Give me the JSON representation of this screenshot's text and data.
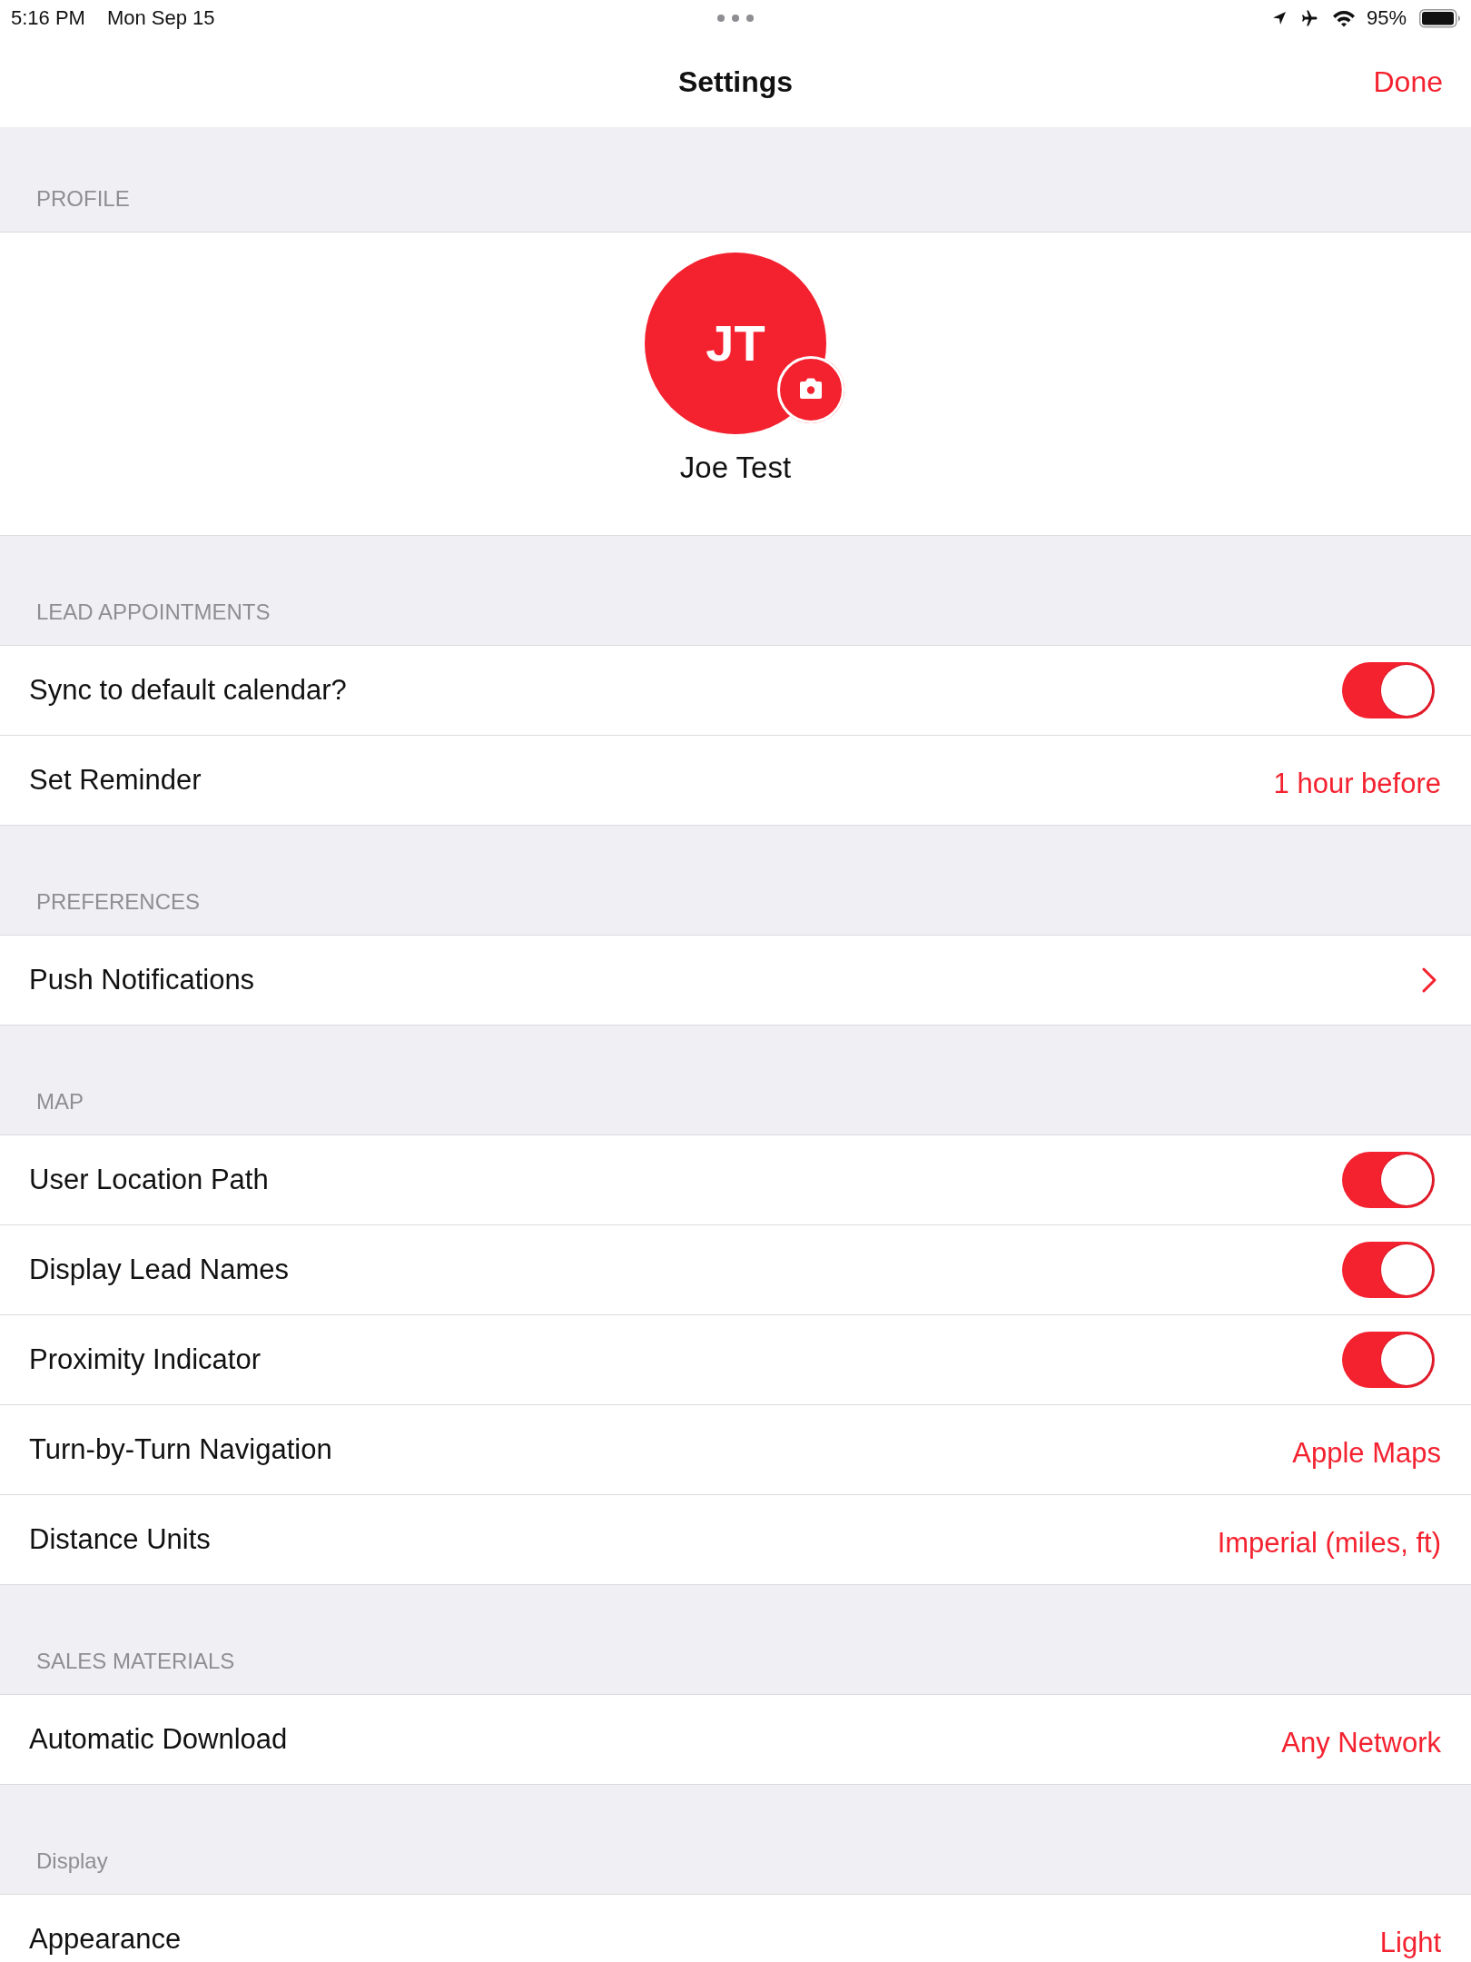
{
  "status_bar": {
    "time": "5:16 PM",
    "date": "Mon Sep 15",
    "battery_text": "95%"
  },
  "nav_bar": {
    "title": "Settings",
    "done_button": "Done"
  },
  "profile": {
    "header": "PROFILE",
    "initials": "JT",
    "name": "Joe Test"
  },
  "sections": [
    {
      "header": "LEAD APPOINTMENTS",
      "rows": [
        {
          "kind": "toggle",
          "label": "Sync to default calendar?",
          "on": true
        },
        {
          "kind": "value",
          "label": "Set Reminder",
          "value": "1 hour before"
        }
      ]
    },
    {
      "header": "PREFERENCES",
      "rows": [
        {
          "kind": "link",
          "label": "Push Notifications"
        }
      ]
    },
    {
      "header": "MAP",
      "rows": [
        {
          "kind": "toggle",
          "label": "User Location Path",
          "on": true
        },
        {
          "kind": "toggle",
          "label": "Display Lead Names",
          "on": true
        },
        {
          "kind": "toggle",
          "label": "Proximity Indicator",
          "on": true
        },
        {
          "kind": "value",
          "label": "Turn-by-Turn Navigation",
          "value": "Apple Maps"
        },
        {
          "kind": "value",
          "label": "Distance Units",
          "value": "Imperial (miles, ft)"
        }
      ]
    },
    {
      "header": "SALES MATERIALS",
      "rows": [
        {
          "kind": "value",
          "label": "Automatic Download",
          "value": "Any Network"
        }
      ]
    },
    {
      "header": "Display",
      "rows": [
        {
          "kind": "value",
          "label": "Appearance",
          "value": "Light"
        }
      ]
    }
  ]
}
